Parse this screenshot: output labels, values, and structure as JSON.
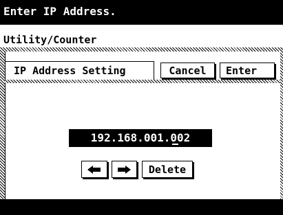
{
  "message": {
    "text": "Enter IP Address."
  },
  "breadcrumb": {
    "text": "Utility/Counter"
  },
  "screen": {
    "title": "IP Address Setting",
    "cancel_label": "Cancel",
    "enter_label": "Enter"
  },
  "ip_field": {
    "value": "192.168.001.002"
  },
  "keypad": {
    "left_icon": "left-arrow-icon",
    "right_icon": "right-arrow-icon",
    "delete_label": "Delete"
  }
}
